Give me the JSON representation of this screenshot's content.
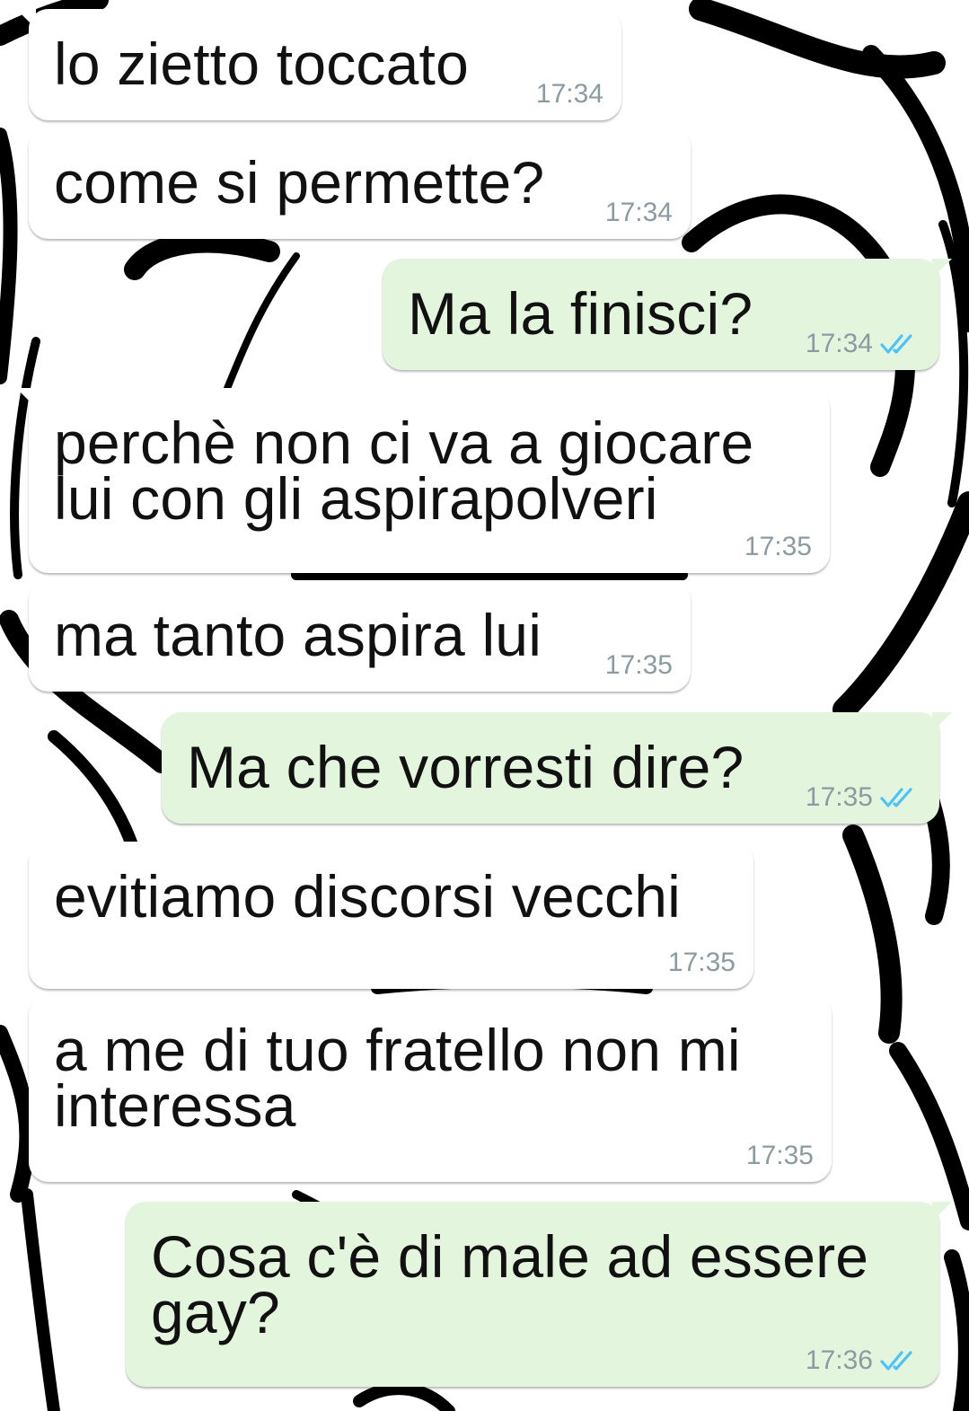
{
  "chat": {
    "tick_color": "#4fc3f7",
    "messages": [
      {
        "direction": "incoming",
        "text": "lo zietto toccato",
        "time": "17:34"
      },
      {
        "direction": "incoming",
        "text": "come si permette?",
        "time": "17:34"
      },
      {
        "direction": "outgoing",
        "text": "Ma la finisci?",
        "time": "17:34",
        "status": "read-double-check"
      },
      {
        "direction": "incoming",
        "text": "perchè non ci va a giocare\nlui con gli aspirapolveri",
        "time": "17:35"
      },
      {
        "direction": "incoming",
        "text": "ma tanto aspira lui",
        "time": "17:35"
      },
      {
        "direction": "outgoing",
        "text": "Ma che vorresti dire?",
        "time": "17:35",
        "status": "read-double-check"
      },
      {
        "direction": "incoming",
        "text": "evitiamo discorsi vecchi",
        "time": "17:35"
      },
      {
        "direction": "incoming",
        "text": "a me di tuo fratello non mi\ninteressa",
        "time": "17:35"
      },
      {
        "direction": "outgoing",
        "text": "Cosa c'è di male ad essere\ngay?",
        "time": "17:36",
        "status": "read-double-check"
      }
    ]
  }
}
